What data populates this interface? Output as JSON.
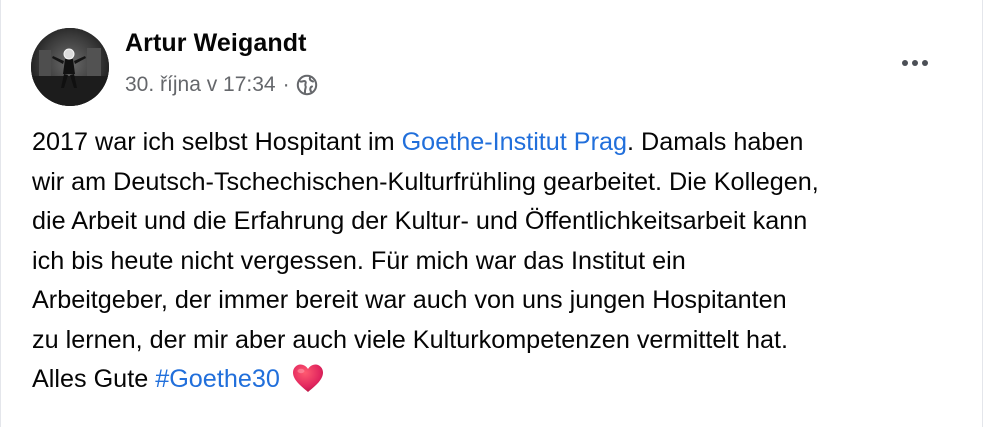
{
  "post": {
    "author": "Artur Weigandt",
    "timestamp": "30. října v 17:34",
    "separator": "·",
    "audience_icon": "globe-icon",
    "menu_icon": "more-options-icon",
    "lines": [
      {
        "a": "2017 war ich selbst Hospitant im ",
        "link": "Goethe-Institut Prag",
        "b": ".  Damals haben"
      },
      {
        "text": "wir am Deutsch-Tschechischen-Kulturfrühling gearbeitet. Die Kollegen,"
      },
      {
        "text": "die Arbeit und die Erfahrung der Kultur- und Öffentlichkeitsarbeit kann"
      },
      {
        "text": "ich bis heute nicht vergessen. Für mich war das Institut ein"
      },
      {
        "text": "Arbeitgeber, der immer bereit war auch von uns jungen Hospitanten"
      },
      {
        "text": "zu lernen, der mir aber auch viele Kulturkompetenzen vermittelt hat."
      },
      {
        "a": "Alles Gute ",
        "hashtag": "#Goethe30",
        "emoji": "red-heart-icon"
      }
    ]
  },
  "colors": {
    "link": "#216fdb",
    "text": "#050505",
    "meta": "#65676b",
    "heart": "#e0245e"
  }
}
